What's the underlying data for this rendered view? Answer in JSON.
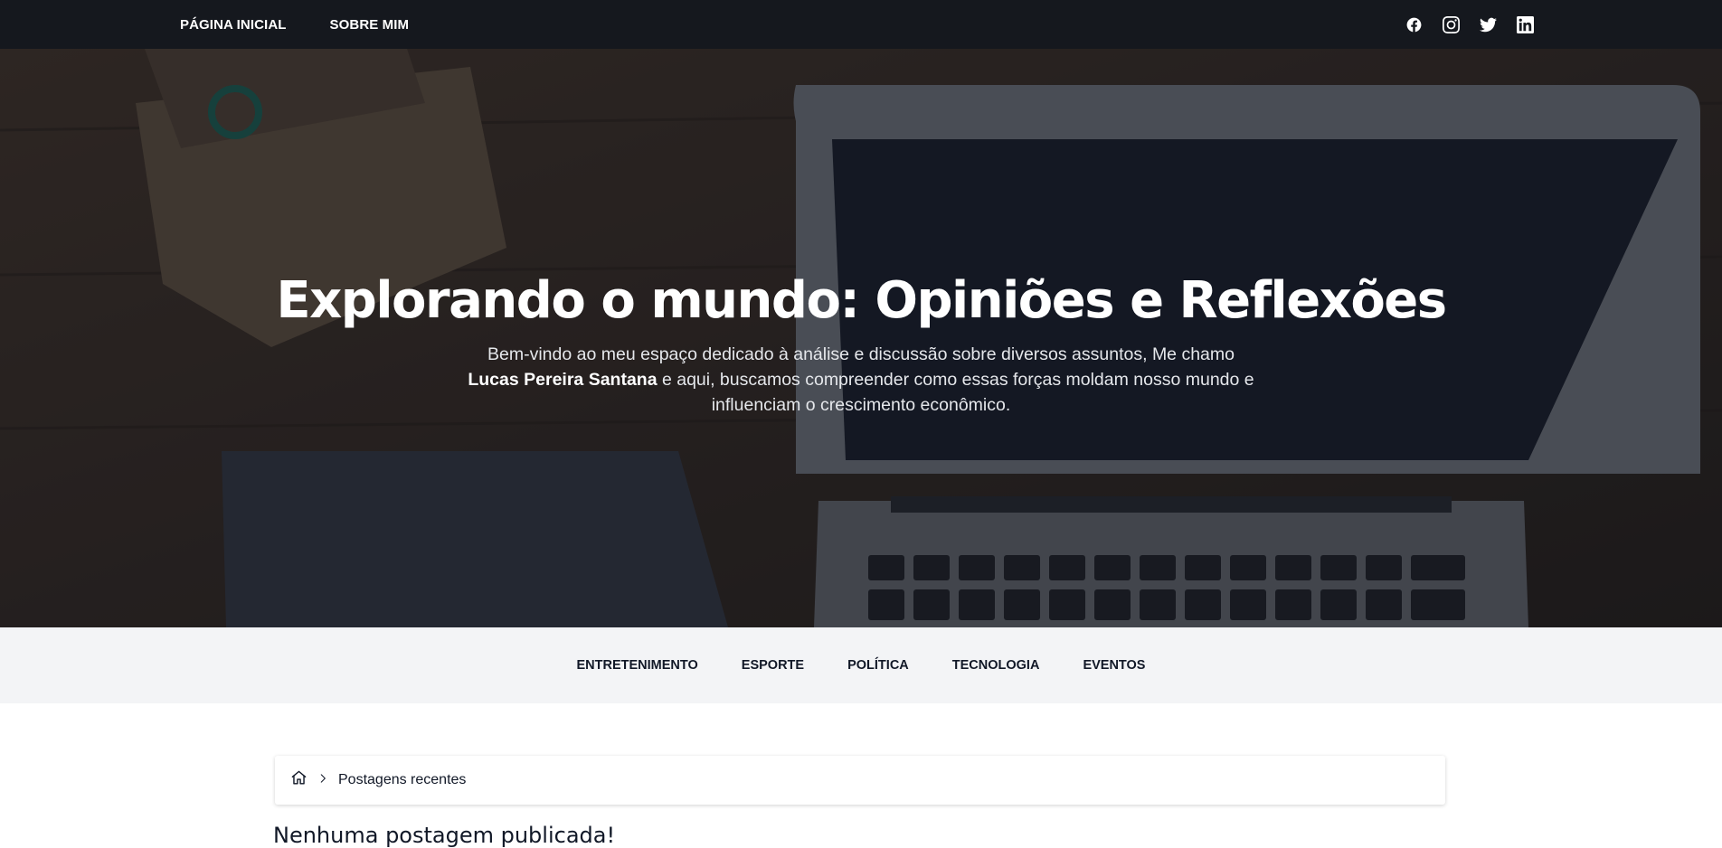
{
  "topbar": {
    "nav": [
      {
        "label": "PÁGINA INICIAL"
      },
      {
        "label": "SOBRE MIM"
      }
    ],
    "social": [
      "facebook-icon",
      "instagram-icon",
      "twitter-icon",
      "linkedin-icon"
    ]
  },
  "hero": {
    "title": "Explorando o mundo: Opiniões e Reflexões",
    "desc_before": "Bem-vindo ao meu espaço dedicado à análise e discussão sobre diversos assuntos, Me chamo ",
    "author": "Lucas Pereira Santana",
    "desc_after": " e aqui, buscamos compreender como essas forças moldam nosso mundo e influenciam o crescimento econômico."
  },
  "categories": [
    {
      "label": "ENTRETENIMENTO"
    },
    {
      "label": "ESPORTE"
    },
    {
      "label": "POLÍTICA"
    },
    {
      "label": "TECNOLOGIA"
    },
    {
      "label": "EVENTOS"
    }
  ],
  "breadcrumb": {
    "current": "Postagens recentes"
  },
  "main": {
    "notice": "Nenhuma postagem publicada!"
  },
  "colors": {
    "topbar": "#15181e",
    "catbar": "#f3f4f6"
  }
}
